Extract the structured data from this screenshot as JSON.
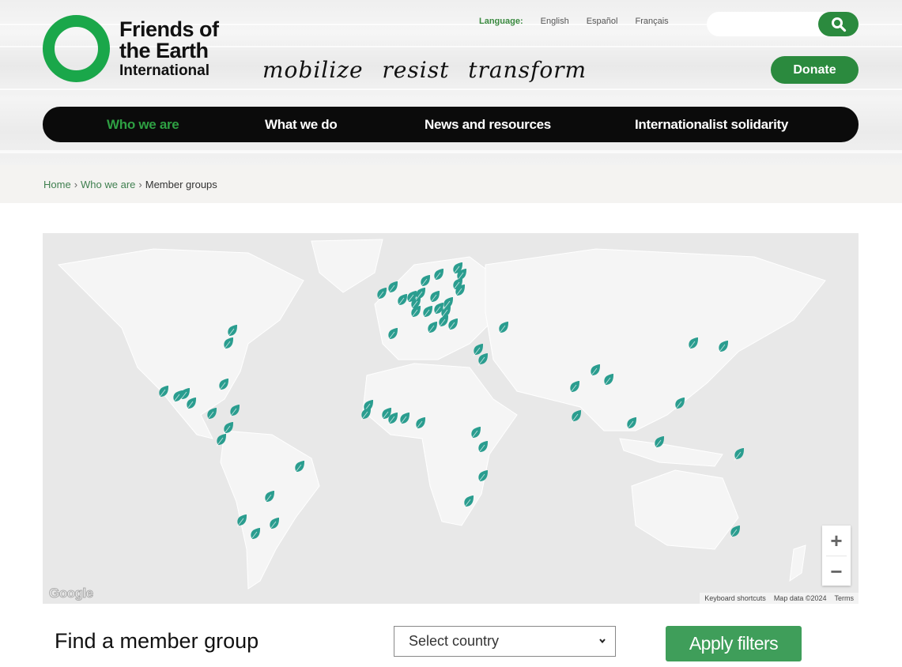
{
  "brand": {
    "name_line1": "Friends of",
    "name_line2": "the Earth",
    "name_line3": "International",
    "tagline": "mobilize resist transform",
    "accent": "#1aa74a",
    "button_green": "#2b8a3e"
  },
  "language": {
    "label": "Language:",
    "options": [
      "English",
      "Español",
      "Français"
    ]
  },
  "search": {
    "placeholder": "",
    "icon": "search-icon"
  },
  "donate_label": "Donate",
  "nav": {
    "items": [
      {
        "label": "Who we are",
        "active": true
      },
      {
        "label": "What we do",
        "active": false
      },
      {
        "label": "News and resources",
        "active": false
      },
      {
        "label": "Internationalist solidarity",
        "active": false
      }
    ]
  },
  "breadcrumb": {
    "items": [
      "Home",
      "Who we are"
    ],
    "current": "Member groups",
    "separator": "›"
  },
  "map": {
    "pin_color": "#2a9d8f",
    "pin_icon": "leaf-pin-icon",
    "zoom_in": "+",
    "zoom_out": "−",
    "logo": "Google",
    "attribution": [
      "Keyboard shortcuts",
      "Map data ©2024",
      "Terms"
    ],
    "pins": [
      {
        "lon": -74,
        "lat": 41
      },
      {
        "lon": -76,
        "lat": 37
      },
      {
        "lon": -104,
        "lat": 19
      },
      {
        "lon": -98,
        "lat": 17
      },
      {
        "lon": -95,
        "lat": 18
      },
      {
        "lon": -92,
        "lat": 14
      },
      {
        "lon": -78,
        "lat": 22
      },
      {
        "lon": -83,
        "lat": 10
      },
      {
        "lon": -73,
        "lat": 11
      },
      {
        "lon": -76,
        "lat": 4
      },
      {
        "lon": -79,
        "lat": -1
      },
      {
        "lon": -45,
        "lat": -12
      },
      {
        "lon": -58,
        "lat": -24
      },
      {
        "lon": -70,
        "lat": -33
      },
      {
        "lon": -56,
        "lat": -34
      },
      {
        "lon": -64,
        "lat": -38
      },
      {
        "lon": -9,
        "lat": 53
      },
      {
        "lon": -4,
        "lat": 55
      },
      {
        "lon": 0,
        "lat": 51
      },
      {
        "lon": 4,
        "lat": 52
      },
      {
        "lon": 6,
        "lat": 50
      },
      {
        "lon": 8,
        "lat": 53
      },
      {
        "lon": 10,
        "lat": 57
      },
      {
        "lon": 14,
        "lat": 52
      },
      {
        "lon": 16,
        "lat": 59
      },
      {
        "lon": 24,
        "lat": 61
      },
      {
        "lon": 26,
        "lat": 59
      },
      {
        "lon": 24,
        "lat": 56
      },
      {
        "lon": 25,
        "lat": 54
      },
      {
        "lon": 6,
        "lat": 47
      },
      {
        "lon": 11,
        "lat": 47
      },
      {
        "lon": 16,
        "lat": 48
      },
      {
        "lon": 19,
        "lat": 47
      },
      {
        "lon": 20,
        "lat": 50
      },
      {
        "lon": 18,
        "lat": 44
      },
      {
        "lon": 22,
        "lat": 43
      },
      {
        "lon": -4,
        "lat": 40
      },
      {
        "lon": 13,
        "lat": 42
      },
      {
        "lon": 44,
        "lat": 42
      },
      {
        "lon": 33,
        "lat": 35
      },
      {
        "lon": 35,
        "lat": 32
      },
      {
        "lon": -15,
        "lat": 13
      },
      {
        "lon": -16,
        "lat": 10
      },
      {
        "lon": -7,
        "lat": 10
      },
      {
        "lon": -4,
        "lat": 8
      },
      {
        "lon": 1,
        "lat": 8
      },
      {
        "lon": 8,
        "lat": 6
      },
      {
        "lon": 32,
        "lat": 2
      },
      {
        "lon": 35,
        "lat": -4
      },
      {
        "lon": 35,
        "lat": -16
      },
      {
        "lon": 29,
        "lat": -26
      },
      {
        "lon": 84,
        "lat": 28
      },
      {
        "lon": 90,
        "lat": 24
      },
      {
        "lon": 75,
        "lat": 21
      },
      {
        "lon": 76,
        "lat": 9
      },
      {
        "lon": 100,
        "lat": 6
      },
      {
        "lon": 121,
        "lat": 14
      },
      {
        "lon": 112,
        "lat": -2
      },
      {
        "lon": 127,
        "lat": 37
      },
      {
        "lon": 140,
        "lat": 36
      },
      {
        "lon": 147,
        "lat": -7
      },
      {
        "lon": 145,
        "lat": -37
      }
    ]
  },
  "filters": {
    "title": "Find a member group",
    "country_placeholder": "Select country",
    "apply_label": "Apply filters"
  }
}
